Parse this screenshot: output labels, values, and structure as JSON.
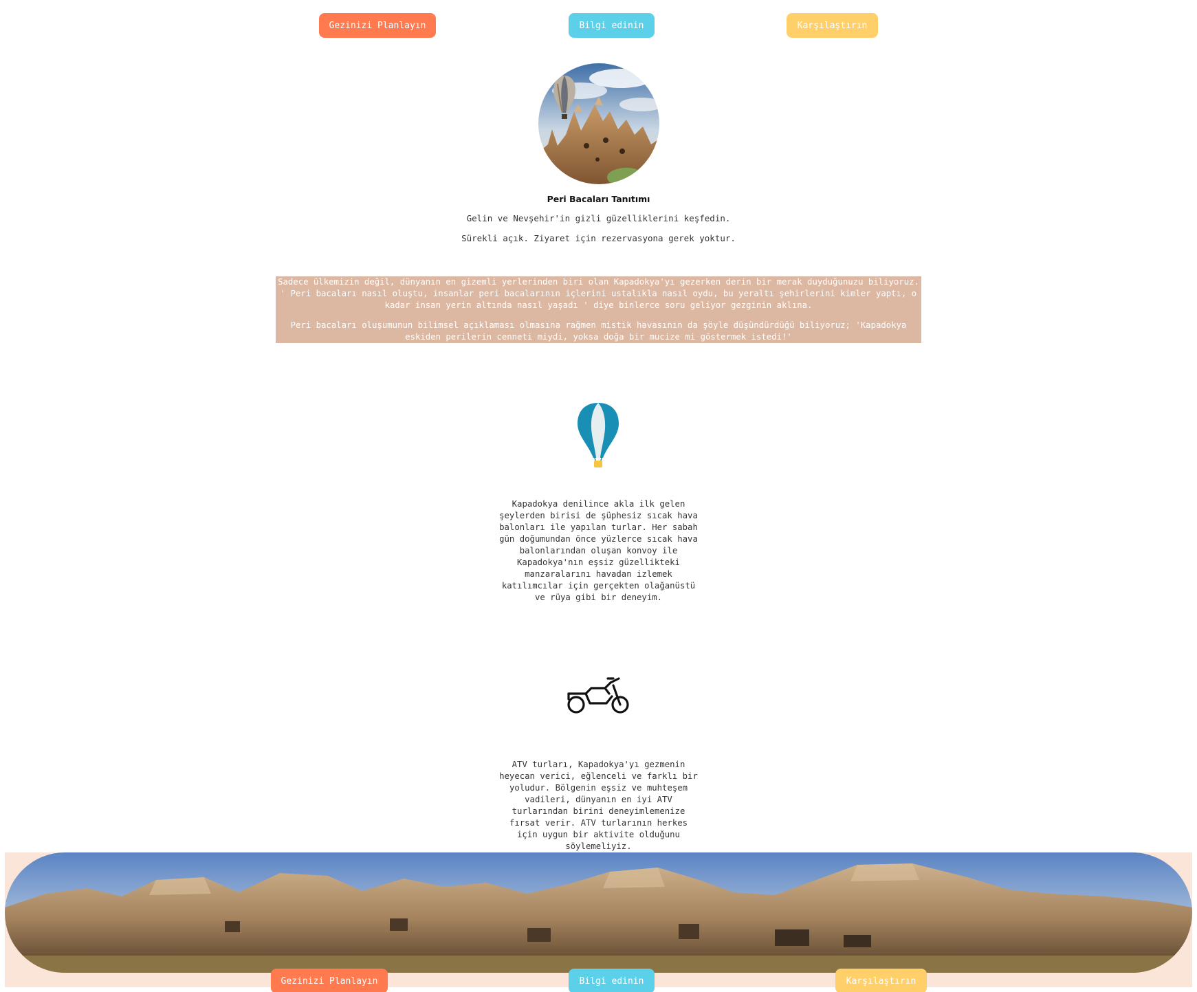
{
  "nav_top": {
    "plan_label": "Gezinizi Planlayın",
    "info_label": "Bilgi edinin",
    "compare_label": "Karşılaştırın"
  },
  "hero": {
    "title": "Peri Bacaları Tanıtımı",
    "subtitle": "Gelin ve Nevşehir'in gizli güzelliklerini keşfedin.",
    "note": "Sürekli açık. Ziyaret için rezervasyona gerek yoktur."
  },
  "intro": {
    "paragraph1": "Sadece ülkemizin değil, dünyanın en gizemli yerlerinden biri olan Kapadokya'yı gezerken derin bir merak duyduğunuzu biliyoruz. ' Peri bacaları nasıl oluştu, insanlar peri bacalarının içlerini ustalıkla nasıl oydu, bu yeraltı şehirlerini kimler yaptı, o kadar insan yerin altında nasıl yaşadı ' diye binlerce soru geliyor gezginin aklına.",
    "paragraph2": "Peri bacaları oluşumunun bilimsel açıklaması olmasına rağmen mistik havasının da şöyle düşündürdüğü biliyoruz; 'Kapadokya eskiden perilerin cenneti miydi, yoksa doğa bir mucize mi göstermek istedi!'"
  },
  "balloon_section": {
    "icon": "hot-air-balloon-icon",
    "text": "Kapadokya denilince akla ilk gelen şeylerden birisi de şüphesiz sıcak hava balonları ile yapılan turlar. Her sabah gün doğumundan önce yüzlerce sıcak hava balonlarından oluşan konvoy ile Kapadokya'nın eşsiz güzellikteki manzaralarını havadan izlemek katılımcılar için gerçekten olağanüstü ve rüya gibi bir deneyim."
  },
  "atv_section": {
    "icon": "atv-motorbike-icon",
    "text": "ATV turları, Kapadokya'yı gezmenin heyecan verici, eğlenceli ve farklı bir yoludur. Bölgenin eşsiz ve muhteşem vadileri, dünyanın en iyi ATV turlarından birini deneyimlemenize fırsat verir. ATV turlarının herkes için uygun bir aktivite olduğunu söylemeliyiz."
  },
  "nav_bottom": {
    "plan_label": "Gezinizi Planlayın",
    "info_label": "Bilgi edinin",
    "compare_label": "Karşılaştırın"
  },
  "colors": {
    "plan_button": "#ff7a4f",
    "info_button": "#5bd0e8",
    "compare_button": "#ffcf6a",
    "intro_box": "#dcb7a2",
    "footer_band": "#fae5d8"
  }
}
